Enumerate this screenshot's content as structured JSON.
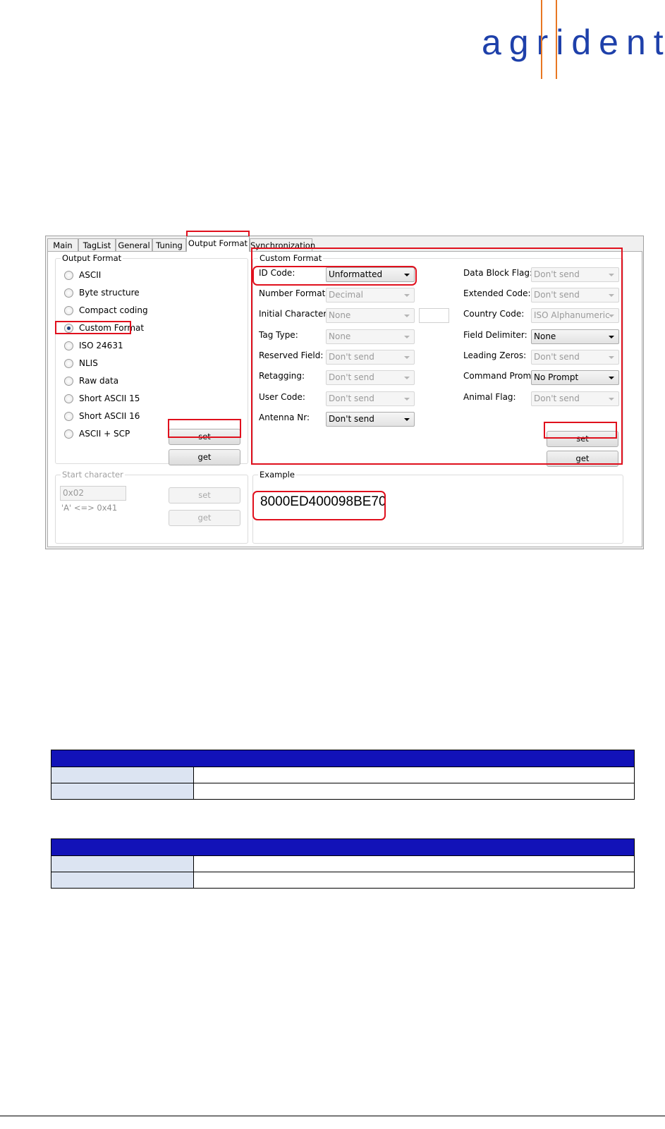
{
  "logo": {
    "text": "agrident"
  },
  "tabs": [
    "Main",
    "TagList",
    "General",
    "Tuning",
    "Output Format",
    "Synchronization"
  ],
  "output_format": {
    "legend": "Output Format",
    "options": [
      "ASCII",
      "Byte structure",
      "Compact coding",
      "Custom Format",
      "ISO 24631",
      "NLIS",
      "Raw data",
      "Short ASCII 15",
      "Short ASCII 16",
      "ASCII + SCP"
    ],
    "selected": "Custom Format",
    "set_label": "set",
    "get_label": "get"
  },
  "start_character": {
    "legend": "Start character",
    "value": "0x02",
    "hint": "'A' <=> 0x41",
    "set_label": "set",
    "get_label": "get"
  },
  "custom_format": {
    "legend": "Custom Format",
    "left": [
      {
        "label": "ID Code:",
        "value": "Unformatted"
      },
      {
        "label": "Number Format:",
        "value": "Decimal"
      },
      {
        "label": "Initial Character:",
        "value": "None"
      },
      {
        "label": "Tag Type:",
        "value": "None"
      },
      {
        "label": "Reserved Field:",
        "value": "Don't send"
      },
      {
        "label": "Retagging:",
        "value": "Don't send"
      },
      {
        "label": "User Code:",
        "value": "Don't send"
      },
      {
        "label": "Antenna Nr:",
        "value": "Don't send"
      }
    ],
    "right": [
      {
        "label": "Data Block Flag:",
        "value": "Don't send"
      },
      {
        "label": "Extended Code:",
        "value": "Don't send"
      },
      {
        "label": "Country Code:",
        "value": "ISO Alphanumeric"
      },
      {
        "label": "Field Delimiter:",
        "value": "None"
      },
      {
        "label": "Leading Zeros:",
        "value": "Don't send"
      },
      {
        "label": "Command Prompt:",
        "value": "No Prompt"
      },
      {
        "label": "Animal Flag:",
        "value": "Don't send"
      }
    ],
    "set_label": "set",
    "get_label": "get"
  },
  "example": {
    "legend": "Example",
    "value": "8000ED400098BE70"
  },
  "colors": {
    "highlight": "#e0101d",
    "table_header": "#1212b8",
    "table_key_cell": "#dce4f2",
    "logo": "#1e40aa",
    "logo_bar": "#e87722"
  }
}
